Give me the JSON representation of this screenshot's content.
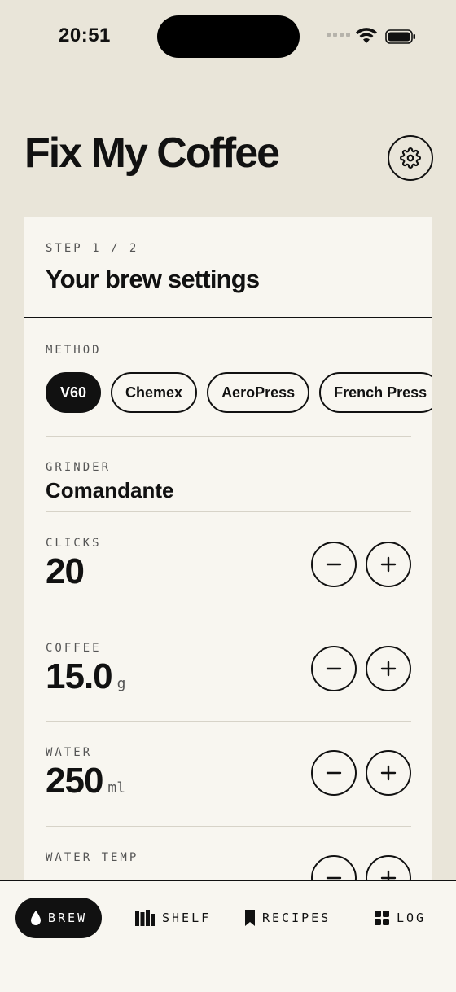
{
  "status_bar": {
    "time": "20:51"
  },
  "header": {
    "title": "Fix My Coffee"
  },
  "card": {
    "step": "STEP 1 / 2",
    "title": "Your brew settings",
    "method": {
      "label": "METHOD",
      "options": [
        "V60",
        "Chemex",
        "AeroPress",
        "French Press"
      ],
      "selected": "V60"
    },
    "grinder": {
      "label": "GRINDER",
      "value": "Comandante"
    },
    "clicks": {
      "label": "CLICKS",
      "value": "20"
    },
    "coffee": {
      "label": "COFFEE",
      "value": "15.0",
      "unit": "g"
    },
    "water": {
      "label": "WATER",
      "value": "250",
      "unit": "ml"
    },
    "water_temp": {
      "label": "WATER TEMP"
    }
  },
  "nav": {
    "items": [
      {
        "label": "BREW",
        "icon": "drop-icon",
        "active": true
      },
      {
        "label": "SHELF",
        "icon": "books-icon",
        "active": false
      },
      {
        "label": "RECIPES",
        "icon": "bookmark-icon",
        "active": false
      },
      {
        "label": "LOG",
        "icon": "grid-icon",
        "active": false
      }
    ]
  },
  "colors": {
    "background": "#e9e5d9",
    "card": "#f8f6f0",
    "ink": "#111111",
    "muted": "#555555"
  }
}
